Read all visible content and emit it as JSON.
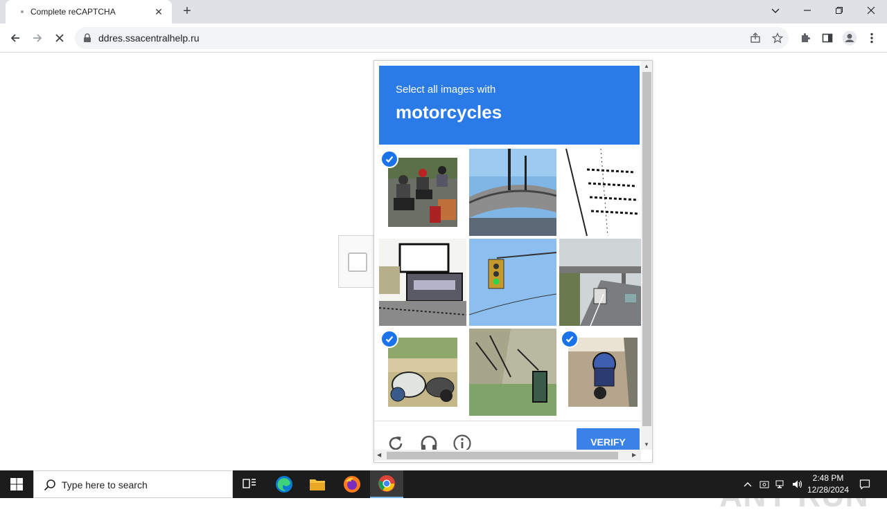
{
  "browser": {
    "tab_title": "Complete reCAPTCHA",
    "close_tab": "✕",
    "new_tab": "+",
    "url": "ddres.ssacentralhelp.ru"
  },
  "captcha": {
    "instruction": "Select all images with",
    "object": "motorcycles",
    "verify_label": "VERIFY",
    "tiles": [
      {
        "subject": "motorcyclists on road",
        "selected": true
      },
      {
        "subject": "overpass bridge",
        "selected": false
      },
      {
        "subject": "road markings",
        "selected": false
      },
      {
        "subject": "cars on street",
        "selected": false
      },
      {
        "subject": "traffic light",
        "selected": false
      },
      {
        "subject": "highway overpass",
        "selected": false
      },
      {
        "subject": "parked scooters",
        "selected": true
      },
      {
        "subject": "trees and pavement",
        "selected": false
      },
      {
        "subject": "motorcycle on road",
        "selected": true
      }
    ]
  },
  "watermark": "ANY RUN",
  "taskbar": {
    "search_placeholder": "Type here to search",
    "time": "2:48 PM",
    "date": "12/28/2024"
  },
  "colors": {
    "header_blue": "#2a7ae8",
    "check_blue": "#1a73e8",
    "verify_blue": "#3b82e8"
  }
}
